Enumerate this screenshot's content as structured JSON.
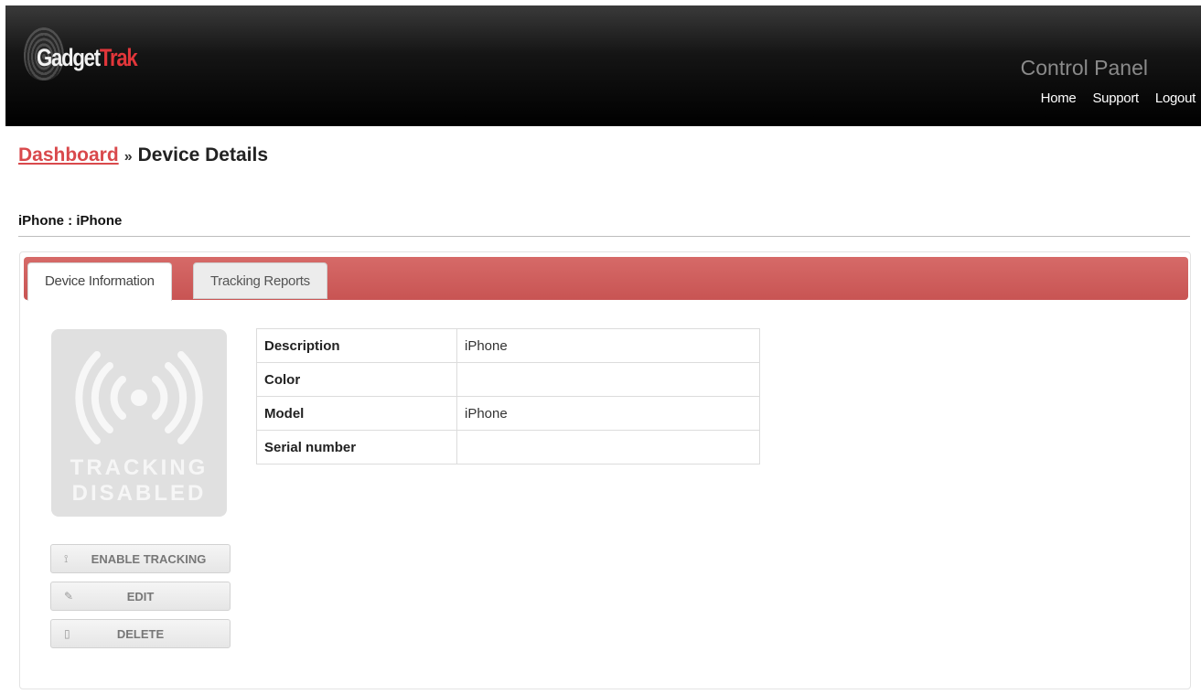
{
  "header": {
    "logo_part1": "Gadget",
    "logo_part2": "Trak",
    "panel_title": "Control Panel",
    "nav": [
      "Home",
      "Support",
      "Logout"
    ]
  },
  "breadcrumb": {
    "link": "Dashboard",
    "separator": "»",
    "current": "Device Details"
  },
  "device_title": "iPhone : iPhone",
  "tabs": [
    "Device Information",
    "Tracking Reports"
  ],
  "tracking_status": {
    "line1": "TRACKING",
    "line2": "DISABLED",
    "icon": "broadcast-icon"
  },
  "actions": [
    {
      "label": "ENABLE TRACKING",
      "icon": "rss-icon"
    },
    {
      "label": "EDIT",
      "icon": "pencil-icon"
    },
    {
      "label": "DELETE",
      "icon": "trash-icon"
    }
  ],
  "details": [
    {
      "key": "Description",
      "value": "iPhone"
    },
    {
      "key": "Color",
      "value": ""
    },
    {
      "key": "Model",
      "value": "iPhone"
    },
    {
      "key": "Serial number",
      "value": ""
    }
  ],
  "colors": {
    "accent_red": "#c85453",
    "link_red": "#d9494c",
    "header_bg": "#000000"
  }
}
